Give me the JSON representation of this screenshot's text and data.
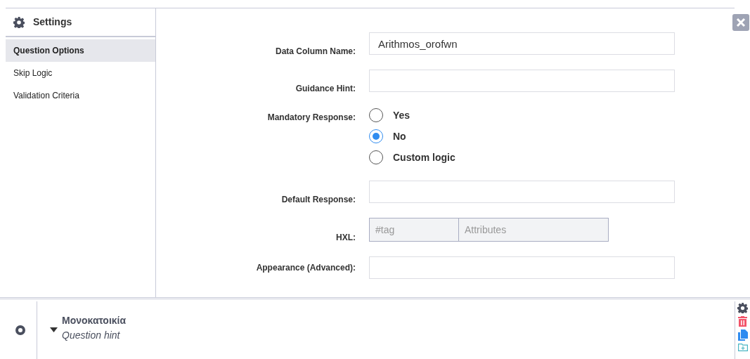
{
  "settings": {
    "title": "Settings"
  },
  "nav": [
    {
      "label": "Question Options",
      "selected": true
    },
    {
      "label": "Skip Logic",
      "selected": false
    },
    {
      "label": "Validation Criteria",
      "selected": false
    }
  ],
  "fields": [
    {
      "kind": "text",
      "label": "Data Column Name:",
      "value": "Arithmos_orofwn"
    },
    {
      "kind": "text",
      "label": "Guidance Hint:"
    },
    {
      "kind": "radio",
      "label": "Mandatory Response:",
      "options": [
        {
          "label": "Yes",
          "selected": false
        },
        {
          "label": "No",
          "selected": true
        },
        {
          "label": "Custom logic",
          "selected": false
        }
      ]
    },
    {
      "kind": "text",
      "label": "Default Response:"
    },
    {
      "kind": "hxl",
      "label": "HXL:",
      "tag_placeholder": "#tag",
      "attributes_placeholder": "Attributes"
    },
    {
      "kind": "text",
      "label": "Appearance (Advanced):"
    }
  ],
  "question": {
    "title": "Μονοκατοικία",
    "hint": "Question hint"
  }
}
